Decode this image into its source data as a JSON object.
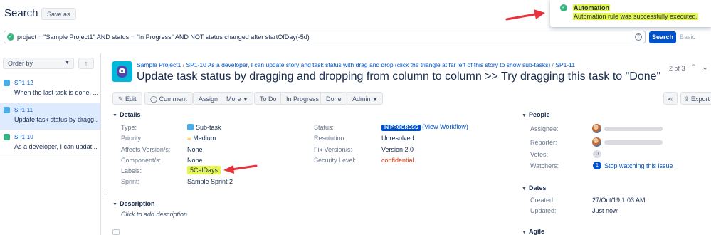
{
  "header": {
    "title": "Search",
    "save_as": "Save as"
  },
  "jql": {
    "query": "project = \"Sample Project1\" AND status = \"In Progress\" AND NOT status changed after startOfDay(-5d)",
    "search_label": "Search",
    "basic_label": "Basic"
  },
  "notification": {
    "title": "Automation",
    "message": "Automation rule was successfully executed."
  },
  "sidebar": {
    "order_by": "Order by",
    "items": [
      {
        "key": "SP1-12",
        "summary": "When the last task is done, ..."
      },
      {
        "key": "SP1-11",
        "summary": "Update task status by dragg..."
      },
      {
        "key": "SP1-10",
        "summary": "As a developer, I can updat..."
      }
    ]
  },
  "issue": {
    "breadcrumb": {
      "project": "Sample Project1",
      "parent": "SP1-10 As a developer, I can update story and task status with drag and drop (click the triangle at far left of this story to show sub-tasks)",
      "key": "SP1-11"
    },
    "title": "Update task status by dragging and dropping from column to column >> Try dragging this task to \"Done\"",
    "pager": "2 of 3",
    "actions": {
      "edit": "Edit",
      "comment": "Comment",
      "assign": "Assign",
      "more": "More",
      "todo": "To Do",
      "inprogress": "In Progress",
      "done": "Done",
      "admin": "Admin",
      "export": "Export"
    },
    "details": {
      "heading": "Details",
      "type_label": "Type:",
      "type_value": "Sub-task",
      "priority_label": "Priority:",
      "priority_value": "Medium",
      "affects_label": "Affects Version/s:",
      "affects_value": "None",
      "component_label": "Component/s:",
      "component_value": "None",
      "labels_label": "Labels:",
      "labels_value": "5CalDays",
      "sprint_label": "Sprint:",
      "sprint_value": "Sample Sprint 2",
      "status_label": "Status:",
      "status_value": "IN PROGRESS",
      "view_workflow": "(View Workflow)",
      "resolution_label": "Resolution:",
      "resolution_value": "Unresolved",
      "fixversion_label": "Fix Version/s:",
      "fixversion_value": "Version 2.0",
      "security_label": "Security Level:",
      "security_value": "confidential"
    },
    "description": {
      "heading": "Description",
      "placeholder": "Click to add description"
    },
    "people": {
      "heading": "People",
      "assignee_label": "Assignee:",
      "reporter_label": "Reporter:",
      "votes_label": "Votes:",
      "votes_value": "0",
      "watchers_label": "Watchers:",
      "watchers_count": "1",
      "watchers_action": "Stop watching this issue"
    },
    "dates": {
      "heading": "Dates",
      "created_label": "Created:",
      "created_value": "27/Oct/19 1:03 AM",
      "updated_label": "Updated:",
      "updated_value": "Just now"
    },
    "agile": {
      "heading": "Agile"
    }
  },
  "colors": {
    "accent": "#0052cc",
    "highlight": "#e6f54a",
    "arrow": "#e8323c",
    "status_badge": "#0052cc",
    "security": "#de350b",
    "success": "#36b37e"
  }
}
